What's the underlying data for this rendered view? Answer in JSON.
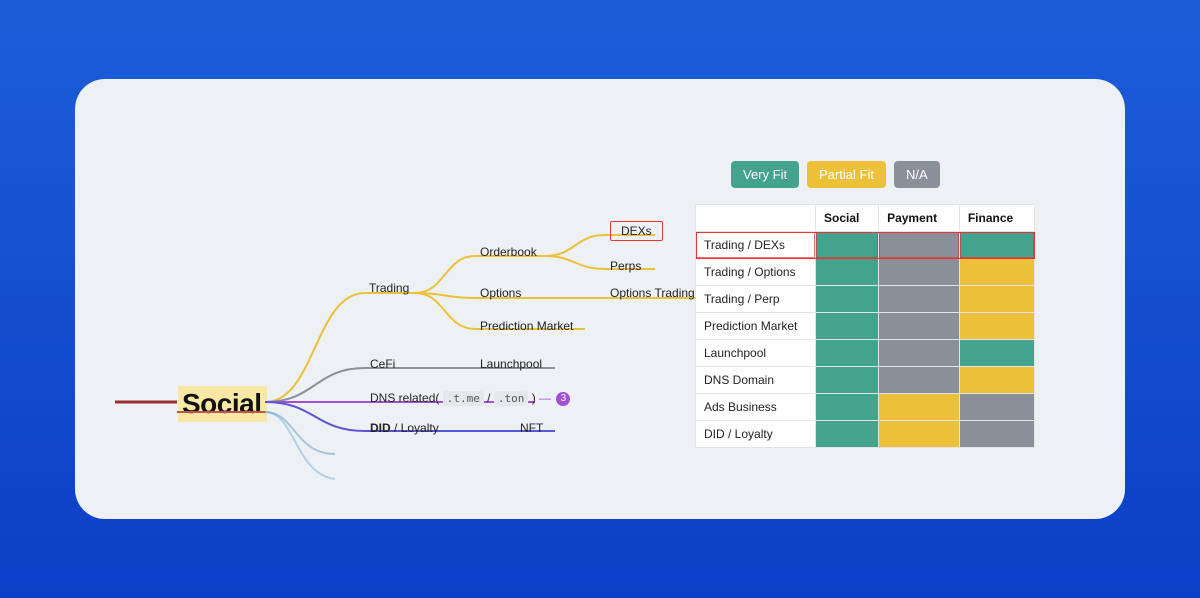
{
  "root": "Social",
  "mindmap": {
    "trading": "Trading",
    "orderbook": "Orderbook",
    "dexs": "DEXs",
    "perps": "Perps",
    "options": "Options",
    "options_trading": "Options Trading",
    "prediction_market": "Prediction Market",
    "cefi": "CeFi",
    "launchpool": "Launchpool",
    "dns_prefix": "DNS related(",
    "dns_tag1": ".t.me",
    "dns_sep": " / ",
    "dns_tag2": ".ton",
    "dns_suffix": ")",
    "dns_badge": "3",
    "did_loyalty_strong": "DID",
    "did_loyalty_rest": " / Loyalty",
    "nft": "NFT"
  },
  "legend": {
    "very_fit": "Very Fit",
    "partial_fit": "Partial Fit",
    "na": "N/A"
  },
  "table": {
    "headers": {
      "social": "Social",
      "payment": "Payment",
      "finance": "Finance"
    },
    "rows": [
      {
        "label": "Trading / DEXs",
        "cells": [
          "green",
          "grey",
          "green"
        ],
        "hl": true
      },
      {
        "label": "Trading / Options",
        "cells": [
          "green",
          "grey",
          "yellow"
        ]
      },
      {
        "label": "Trading / Perp",
        "cells": [
          "green",
          "grey",
          "yellow"
        ]
      },
      {
        "label": "Prediction Market",
        "cells": [
          "green",
          "grey",
          "yellow"
        ]
      },
      {
        "label": "Launchpool",
        "cells": [
          "green",
          "grey",
          "green"
        ]
      },
      {
        "label": "DNS Domain",
        "cells": [
          "green",
          "grey",
          "yellow"
        ]
      },
      {
        "label": "Ads Business",
        "cells": [
          "green",
          "yellow",
          "grey"
        ]
      },
      {
        "label": "DID / Loyalty",
        "cells": [
          "green",
          "yellow",
          "grey"
        ]
      }
    ]
  }
}
